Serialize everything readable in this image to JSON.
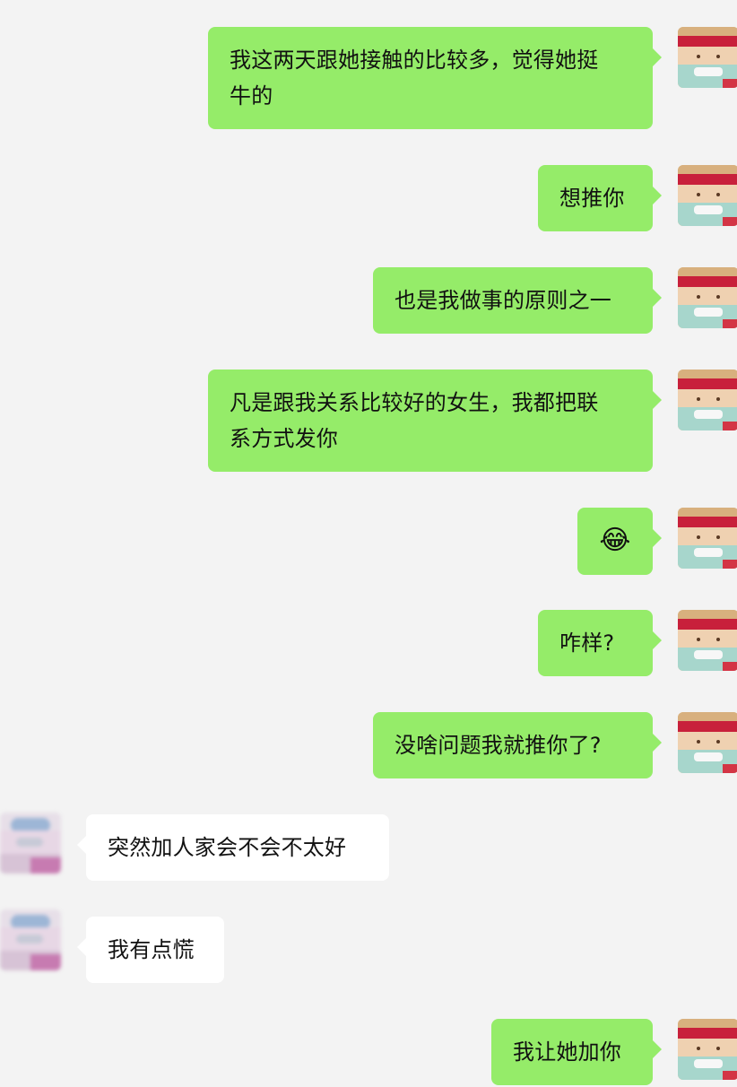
{
  "colors": {
    "sent_bg": "#95ec69",
    "recv_bg": "#ffffff",
    "chat_bg": "#f3f3f3"
  },
  "messages": [
    {
      "sender": "me",
      "text": "我这两天跟她接触的比较多，觉得她挺牛的",
      "lines": [
        "我这两天跟她接触的比较多，觉得她挺",
        "牛的"
      ]
    },
    {
      "sender": "me",
      "text": "想推你"
    },
    {
      "sender": "me",
      "text": "也是我做事的原则之一"
    },
    {
      "sender": "me",
      "text": "凡是跟我关系比较好的女生，我都把联系方式发你",
      "lines": [
        "凡是跟我关系比较好的女生，我都把联",
        "系方式发你"
      ]
    },
    {
      "sender": "me",
      "text": "😂"
    },
    {
      "sender": "me",
      "text": "咋样?"
    },
    {
      "sender": "me",
      "text": "没啥问题我就推你了?"
    },
    {
      "sender": "other",
      "text": "突然加人家会不会不太好"
    },
    {
      "sender": "other",
      "text": "我有点慌"
    },
    {
      "sender": "me",
      "text": "我让她加你"
    }
  ],
  "avatars": {
    "me_icon": "straw-hat-character-avatar-icon",
    "other_icon": "blurred-pink-avatar-icon"
  }
}
